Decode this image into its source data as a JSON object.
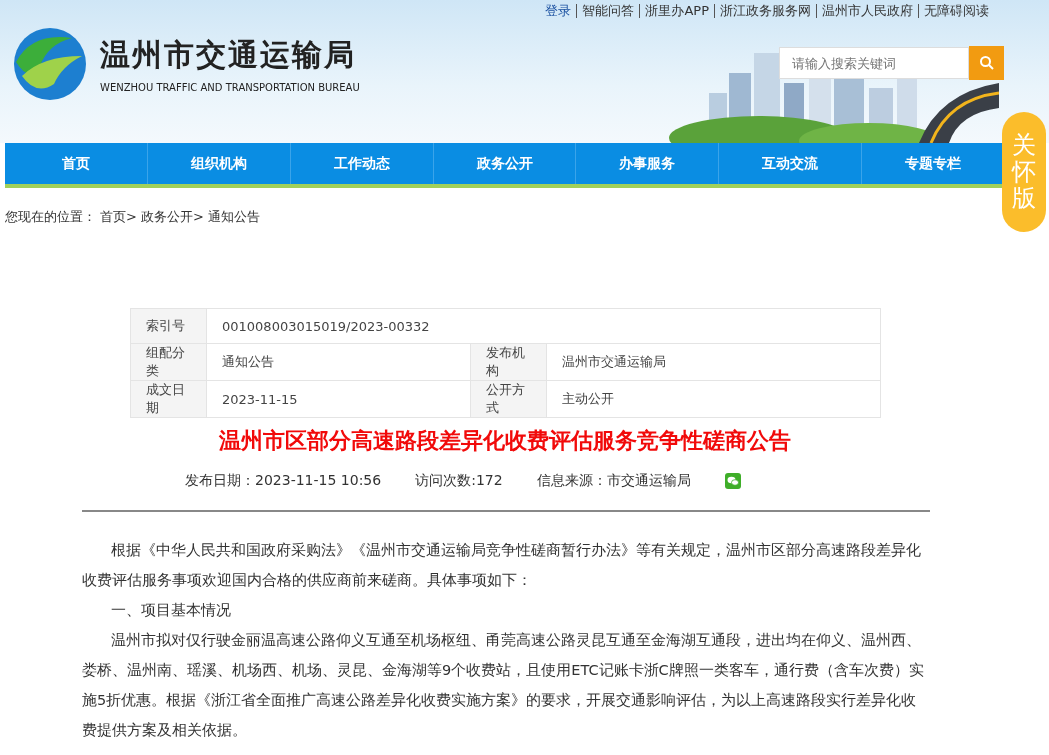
{
  "top_links": [
    {
      "label": "登录",
      "kind": "login"
    },
    {
      "label": "智能问答",
      "kind": "link"
    },
    {
      "label": "浙里办APP",
      "kind": "link"
    },
    {
      "label": "浙江政务服务网",
      "kind": "link"
    },
    {
      "label": "温州市人民政府",
      "kind": "link"
    },
    {
      "label": "无障碍阅读",
      "kind": "link"
    }
  ],
  "logo": {
    "title": "温州市交通运输局",
    "subtitle": "WENZHOU TRAFFIC AND TRANSPORTATION BUREAU"
  },
  "search": {
    "placeholder": "请输入搜索关键词"
  },
  "care_badge": "关怀版",
  "nav": [
    {
      "label": "首页"
    },
    {
      "label": "组织机构"
    },
    {
      "label": "工作动态"
    },
    {
      "label": "政务公开"
    },
    {
      "label": "办事服务"
    },
    {
      "label": "互动交流"
    },
    {
      "label": "专题专栏"
    }
  ],
  "breadcrumb": {
    "prefix": "您现在的位置：",
    "items": [
      "首页>",
      "政务公开>",
      "通知公告"
    ]
  },
  "info_table": [
    {
      "cells": [
        {
          "label": "索引号",
          "value": "001008003015019/2023-00332"
        }
      ]
    },
    {
      "cells": [
        {
          "label": "组配分类",
          "value": "通知公告"
        },
        {
          "label": "发布机构",
          "value": "温州市交通运输局"
        }
      ]
    },
    {
      "cells": [
        {
          "label": "成文日期",
          "value": "2023-11-15"
        },
        {
          "label": "公开方式",
          "value": "主动公开"
        }
      ]
    }
  ],
  "article": {
    "title": "温州市区部分高速路段差异化收费评估服务竞争性磋商公告",
    "meta": [
      "发布日期：2023-11-15 10:56",
      "访问次数:172",
      "信息来源：市交通运输局"
    ],
    "paragraphs": [
      "根据《中华人民共和国政府采购法》《温州市交通运输局竞争性磋商暂行办法》等有关规定，温州市区部分高速路段差异化收费评估服务事项欢迎国内合格的供应商前来磋商。具体事项如下：",
      "一、项目基本情况",
      "温州市拟对仅行驶金丽温高速公路仰义互通至机场枢纽、甬莞高速公路灵昆互通至金海湖互通段，进出均在仰义、温州西、娄桥、温州南、瑶溪、机场西、机场、灵昆、金海湖等9个收费站，且使用ETC记账卡浙C牌照一类客车，通行费（含车次费）实施5折优惠。根据《浙江省全面推广高速公路差异化收费实施方案》的要求，开展交通影响评估，为以上高速路段实行差异化收费提供方案及相关依据。"
    ]
  }
}
